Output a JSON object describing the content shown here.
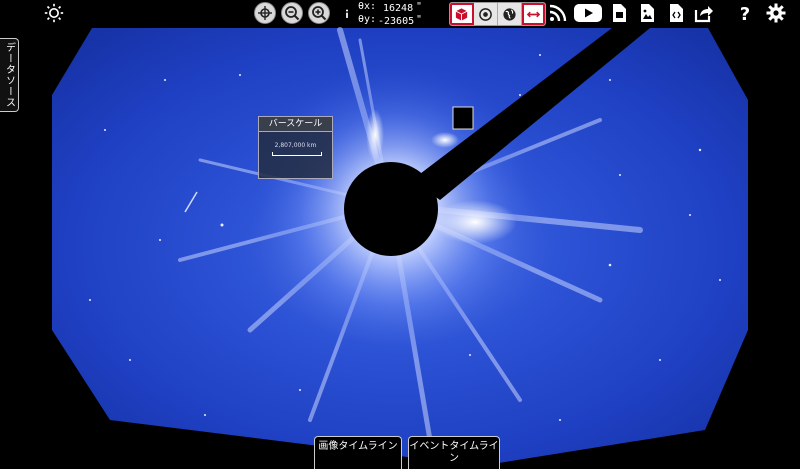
{
  "toolbar": {
    "coord_x_label": "θx:",
    "coord_x_value": "16248",
    "coord_y_label": "θy:",
    "coord_y_value": "-23605",
    "coord_x_unit": "\"",
    "coord_y_unit": "\"",
    "icons": {
      "settings_sun": "sun-outline-icon",
      "center": "crosshair-icon",
      "zoom_out": "zoom-out-icon",
      "zoom_in": "zoom-in-icon",
      "info": "info-icon",
      "view_mode": "cube-icon",
      "sun_view": "sun-disc-icon",
      "earth": "earth-icon",
      "scale_ruler": "ruler-icon",
      "rss": "rss-icon",
      "youtube": "youtube-icon",
      "jpx": "document-icon",
      "image_download": "image-icon",
      "embed": "code-document-icon",
      "share": "share-icon",
      "help": "help-icon",
      "settings": "gear-icon"
    }
  },
  "sidebar": {
    "data_sources_label": "データソース"
  },
  "scale_box": {
    "title": "バースケール",
    "value": "2,807,000 km"
  },
  "timeline": {
    "image_tab": "画像タイムライン",
    "event_tab": "イベントタイムライン"
  },
  "colors": {
    "accent_red": "#c8102e",
    "sky_blue": "#1f43c9"
  }
}
